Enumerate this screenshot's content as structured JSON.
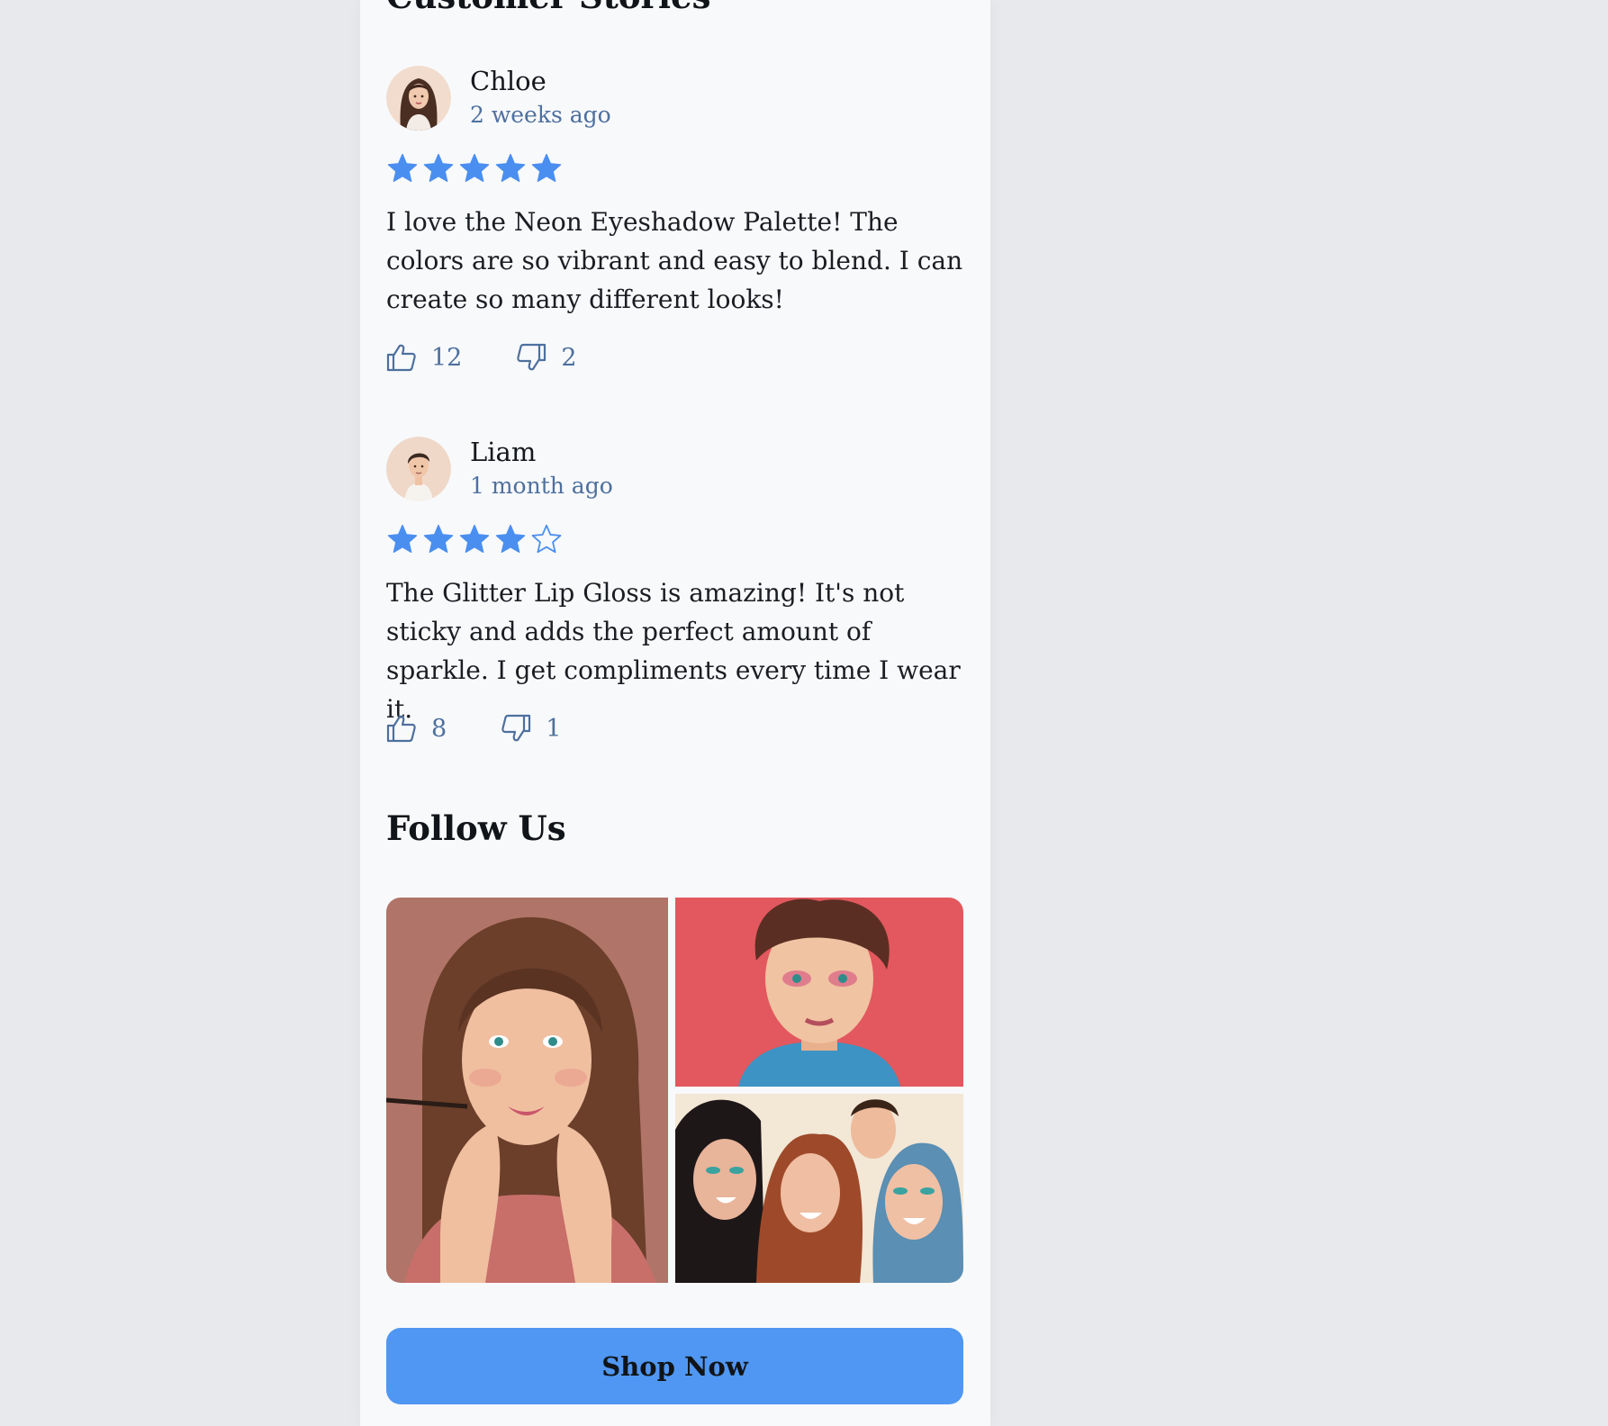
{
  "customer_stories": {
    "title": "Customer Stories",
    "reviews": [
      {
        "name": "Chloe",
        "time": "2 weeks ago",
        "rating": 5,
        "max_rating": 5,
        "text": "I love the Neon Eyeshadow Palette! The colors are so vibrant and easy to blend. I can create so many different looks!",
        "likes": "12",
        "dislikes": "2",
        "avatar": "woman-avatar"
      },
      {
        "name": "Liam",
        "time": "1 month ago",
        "rating": 4,
        "max_rating": 5,
        "text": "The Glitter Lip Gloss is amazing! It's not sticky and adds the perfect amount of sparkle. I get compliments every time I wear it.",
        "likes": "8",
        "dislikes": "1",
        "avatar": "man-avatar"
      }
    ]
  },
  "follow_us": {
    "title": "Follow Us",
    "gallery": [
      "woman-applying-makeup",
      "young-person-with-pink-eyeshadow",
      "group-of-friends-laughing"
    ]
  },
  "cta": {
    "label": "Shop Now"
  },
  "colors": {
    "accent": "#4f97f2",
    "star": "#4a8ff0",
    "meta_text": "#4e709e",
    "background": "#f8f9fb"
  }
}
